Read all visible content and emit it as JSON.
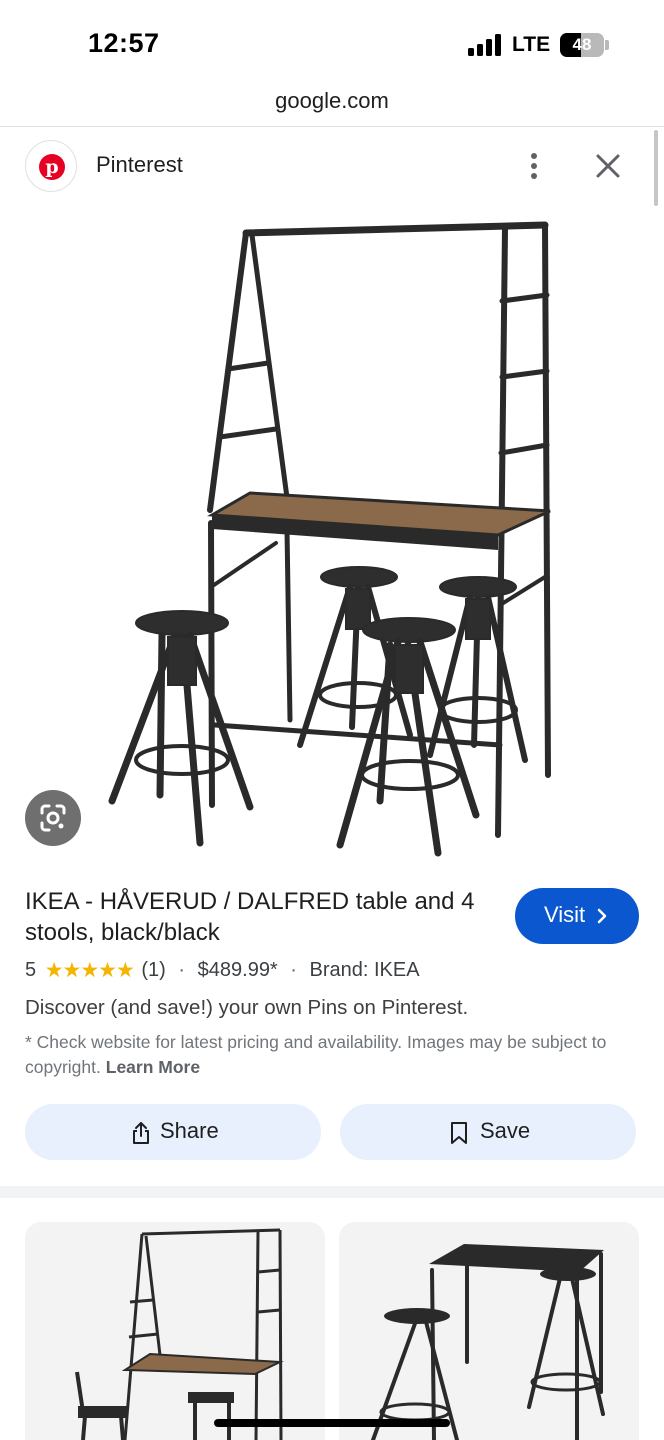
{
  "status_bar": {
    "time": "12:57",
    "network": "LTE",
    "battery": "48",
    "battery_level": 0.48
  },
  "browser": {
    "url": "google.com"
  },
  "source": {
    "name": "Pinterest",
    "logo_letter": "p",
    "brand_color": "#e60023"
  },
  "product": {
    "title": "IKEA - HÅVERUD / DALFRED table and 4 stools, black/black",
    "rating": "5",
    "stars_count": 5,
    "review_count": "(1)",
    "price": "$489.99*",
    "brand": "Brand: IKEA",
    "tagline": "Discover (and save!) your own Pins on Pinterest.",
    "disclaimer": "* Check website for latest pricing and availability. Images may be subject to copyright.",
    "learn_more": "Learn More"
  },
  "buttons": {
    "visit": "Visit",
    "share": "Share",
    "save": "Save"
  },
  "icons": {
    "lens": "google-lens-icon",
    "more": "more-vert-icon",
    "close": "close-icon",
    "share": "share-icon",
    "save": "bookmark-icon",
    "chevron": "chevron-right-icon"
  },
  "colors": {
    "accent": "#0b57d0",
    "tonal_button": "#e8f0fe",
    "star": "#f4b400",
    "pinterest": "#e60023"
  }
}
